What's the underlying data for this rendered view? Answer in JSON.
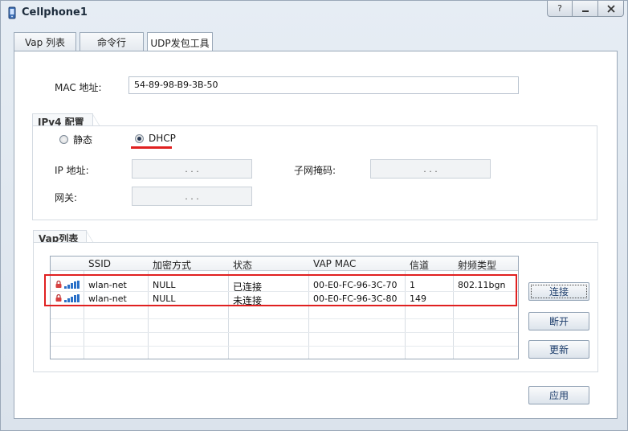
{
  "window": {
    "title": "Cellphone1"
  },
  "tabs": [
    "Vap 列表",
    "命令行",
    "UDP发包工具"
  ],
  "mac": {
    "label": "MAC 地址:",
    "value": "54-89-98-B9-3B-50"
  },
  "ipv4": {
    "group_title": "IPv4 配置",
    "static_label": "静态",
    "dhcp_label": "DHCP",
    "selected": "DHCP",
    "ip_label": "IP 地址:",
    "mask_label": "子网掩码:",
    "gateway_label": "网关:",
    "ip_dots": ".  .  .",
    "mask_dots": ".  .  .",
    "gw_dots": ".  .  ."
  },
  "vap": {
    "group_title": "Vap列表",
    "columns": [
      "SSID",
      "加密方式",
      "状态",
      "VAP MAC",
      "信道",
      "射频类型"
    ],
    "rows": [
      {
        "ssid": "wlan-net",
        "enc": "NULL",
        "status": "已连接",
        "mac": "00-E0-FC-96-3C-70",
        "channel": "1",
        "radio": "802.11bgn"
      },
      {
        "ssid": "wlan-net",
        "enc": "NULL",
        "status": "未连接",
        "mac": "00-E0-FC-96-3C-80",
        "channel": "149",
        "radio": ""
      }
    ]
  },
  "buttons": {
    "connect": "连接",
    "disconnect": "断开",
    "refresh": "更新",
    "apply": "应用"
  },
  "colors": {
    "highlight": "#e02020",
    "signal": "#2a70c8"
  }
}
